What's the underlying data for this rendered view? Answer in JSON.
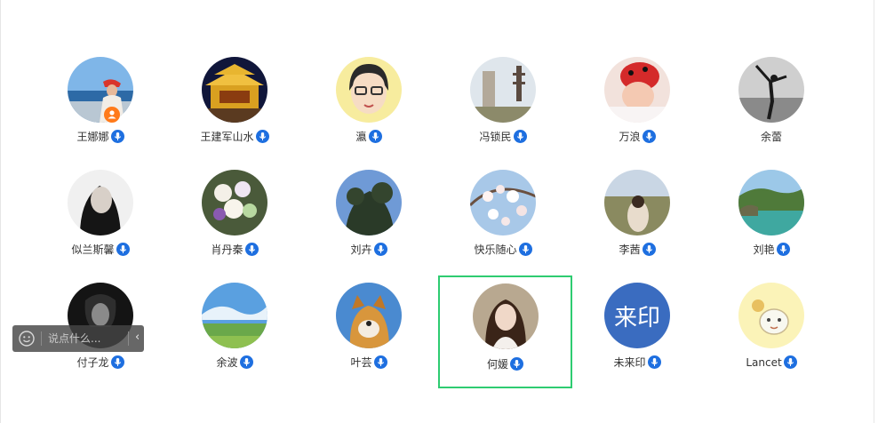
{
  "members": [
    {
      "name": "王娜娜",
      "avatar": "photo-woman-by-sea",
      "owner": true,
      "mic": true
    },
    {
      "name": "王建军山水",
      "avatar": "photo-lit-temple-night",
      "owner": false,
      "mic": true
    },
    {
      "name": "瀛",
      "avatar": "cartoon-girl-glasses",
      "owner": false,
      "mic": true
    },
    {
      "name": "冯锁民",
      "avatar": "photo-stone-monument-pagoda",
      "owner": false,
      "mic": true
    },
    {
      "name": "万浪",
      "avatar": "photo-baby-red-hat",
      "owner": false,
      "mic": true
    },
    {
      "name": "余蕾",
      "avatar": "photo-dancer-bw",
      "owner": false,
      "mic": false
    },
    {
      "name": "似兰斯馨",
      "avatar": "photo-woman-portrait-bw",
      "owner": false,
      "mic": true
    },
    {
      "name": "肖丹秦",
      "avatar": "photo-flower-bouquet",
      "owner": false,
      "mic": true
    },
    {
      "name": "刘卉",
      "avatar": "photo-tree-blue-sky",
      "owner": false,
      "mic": true
    },
    {
      "name": "快乐随心",
      "avatar": "photo-white-blossoms",
      "owner": false,
      "mic": true
    },
    {
      "name": "李茜",
      "avatar": "photo-woman-scenery",
      "owner": false,
      "mic": true
    },
    {
      "name": "刘艳",
      "avatar": "photo-green-lake-cliffs",
      "owner": false,
      "mic": true
    },
    {
      "name": "付子龙",
      "avatar": "photo-man-dark-bw",
      "owner": false,
      "mic": true
    },
    {
      "name": "余波",
      "avatar": "photo-anime-sky-field",
      "owner": false,
      "mic": true
    },
    {
      "name": "叶芸",
      "avatar": "photo-shiba-dog",
      "owner": false,
      "mic": true
    },
    {
      "name": "何媛",
      "avatar": "photo-woman-smiling",
      "owner": false,
      "mic": true,
      "selected": true
    },
    {
      "name": "未来印",
      "avatar": "text-avatar",
      "avatar_text": "来印",
      "owner": false,
      "mic": true
    },
    {
      "name": "Lancet",
      "avatar": "cartoon-sheep",
      "owner": false,
      "mic": true
    }
  ],
  "comment_bar": {
    "placeholder": "说点什么...",
    "emoji_icon": "smile-icon",
    "collapse_icon": "chevron-left-icon",
    "collapse_glyph": "‹"
  },
  "colors": {
    "mic_badge": "#1e6fe0",
    "owner_badge": "#ff7a1a",
    "selected_border": "#2ecc71",
    "text_avatar_bg": "#3a6cc0"
  }
}
